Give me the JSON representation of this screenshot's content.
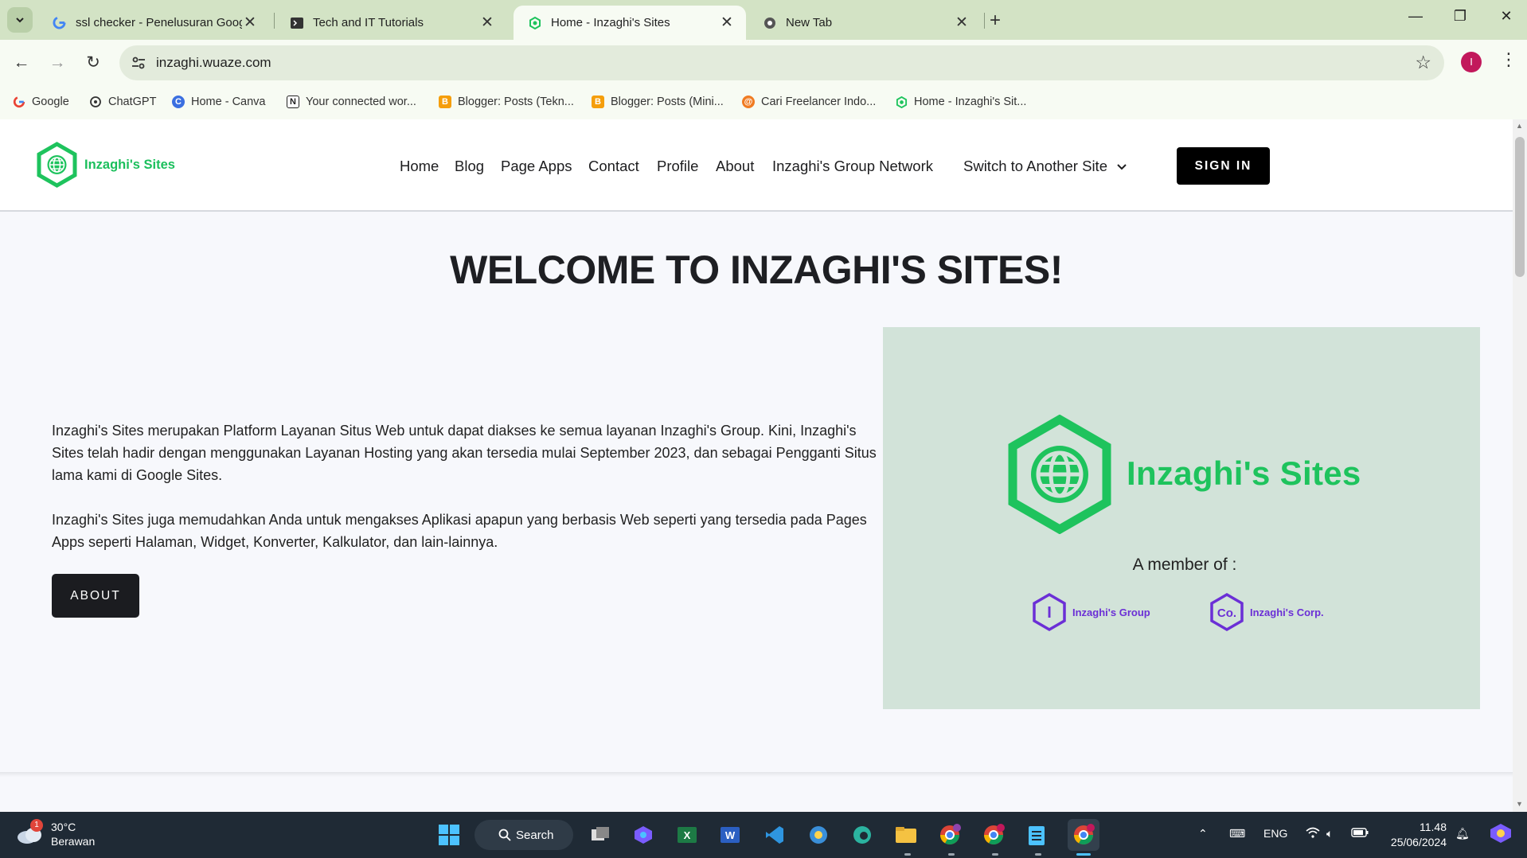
{
  "browser": {
    "tabs": [
      {
        "title": "ssl checker - Penelusuran Goog",
        "icon": "google-icon",
        "active": false
      },
      {
        "title": "Tech and IT Tutorials",
        "icon": "terminal-icon",
        "active": false
      },
      {
        "title": "Home - Inzaghi's Sites",
        "icon": "inzaghi-sites-icon",
        "active": true
      },
      {
        "title": "New Tab",
        "icon": "chrome-icon",
        "active": false
      }
    ],
    "url": "inzaghi.wuaze.com",
    "profile_initial": "I",
    "bookmarks": [
      {
        "label": "Google",
        "icon": "google-icon"
      },
      {
        "label": "ChatGPT",
        "icon": "chatgpt-icon"
      },
      {
        "label": "Home - Canva",
        "icon": "canva-icon"
      },
      {
        "label": "Your connected wor...",
        "icon": "notion-icon"
      },
      {
        "label": "Blogger: Posts (Tekn...",
        "icon": "blogger-icon"
      },
      {
        "label": "Blogger: Posts (Mini...",
        "icon": "blogger-icon"
      },
      {
        "label": "Cari Freelancer Indo...",
        "icon": "freelancer-icon"
      },
      {
        "label": "Home - Inzaghi's Sit...",
        "icon": "inzaghi-sites-icon"
      }
    ]
  },
  "site": {
    "brand": "Inzaghi's Sites",
    "nav": [
      "Home",
      "Blog",
      "Page Apps",
      "Contact",
      "Profile",
      "About",
      "Inzaghi's Group Network"
    ],
    "switch_label": "Switch to Another Site",
    "signin_label": "SIGN IN",
    "headline": "WELCOME TO INZAGHI'S SITES!",
    "paragraph1": "Inzaghi's Sites merupakan Platform Layanan Situs Web untuk dapat diakses ke semua layanan Inzaghi's Group. Kini, Inzaghi's Sites telah hadir dengan menggunakan Layanan Hosting yang akan tersedia mulai September 2023, dan sebagai Pengganti Situs lama kami di Google Sites.",
    "paragraph2": "Inzaghi's Sites juga memudahkan Anda untuk mengakses Aplikasi apapun yang berbasis Web seperti yang tersedia pada Pages Apps seperti Halaman, Widget, Konverter, Kalkulator, dan lain-lainnya.",
    "about_button": "ABOUT",
    "hero": {
      "brand": "Inzaghi's Sites",
      "member_of": "A member of :",
      "members": [
        {
          "label": "Inzaghi's Group",
          "glyph": "I"
        },
        {
          "label": "Inzaghi's Corp.",
          "glyph": "Co."
        }
      ]
    },
    "colors": {
      "brand_green": "#1ec35d",
      "member_purple": "#6b2fd6",
      "hero_bg": "#d2e3d9"
    }
  },
  "taskbar": {
    "weather_temp": "30°C",
    "weather_desc": "Berawan",
    "weather_badge": "1",
    "search_label": "Search",
    "language": "ENG",
    "time": "11.48",
    "date": "25/06/2024"
  }
}
